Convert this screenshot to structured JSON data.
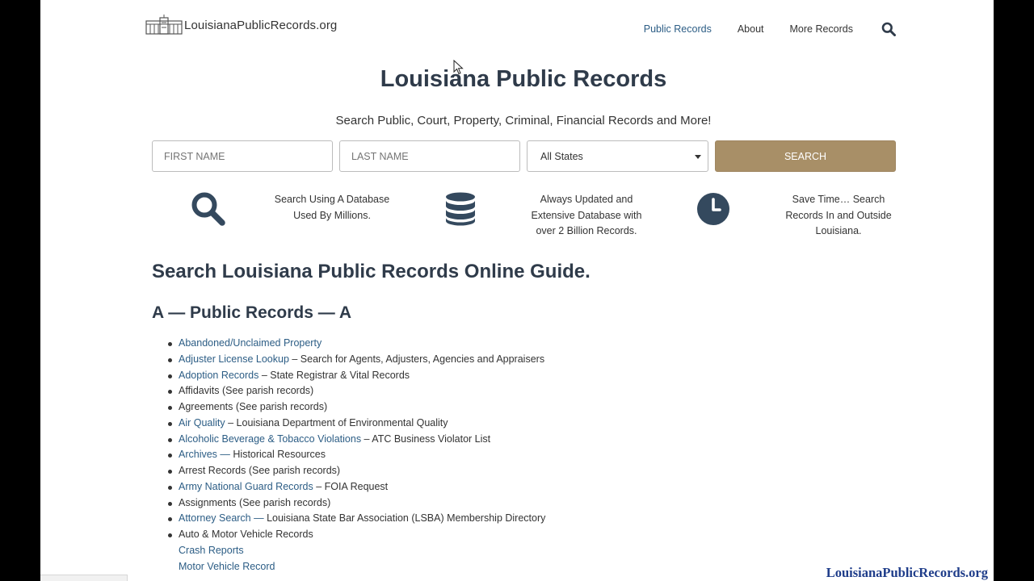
{
  "header": {
    "logo_text": "LouisianaPublicRecords.org",
    "nav": [
      {
        "label": "Public Records",
        "active": true
      },
      {
        "label": "About",
        "active": false
      },
      {
        "label": "More Records",
        "active": false
      }
    ],
    "search_icon": "search-icon"
  },
  "hero": {
    "title": "Louisiana Public Records",
    "subtitle": "Search Public, Court, Property, Criminal, Financial Records and More!"
  },
  "search_form": {
    "first_name_placeholder": "FIRST NAME",
    "last_name_placeholder": "LAST NAME",
    "state_selected": "All States",
    "button_label": "SEARCH",
    "button_color": "#a88f67"
  },
  "features": [
    {
      "icon": "magnifier-icon",
      "lines": [
        "Search Using A Database",
        "Used By Millions."
      ]
    },
    {
      "icon": "database-icon",
      "lines": [
        "Always Updated and",
        "Extensive Database with",
        "over 2 Billion Records."
      ]
    },
    {
      "icon": "clock-icon",
      "lines": [
        "Save Time… Search",
        "Records In and Outside",
        "Louisiana."
      ]
    }
  ],
  "guide": {
    "title": "Search Louisiana Public Records Online Guide.",
    "section_title": "A — Public Records — A",
    "items": [
      {
        "link": "Abandoned/Unclaimed Property",
        "text": ""
      },
      {
        "link": "Adjuster License Lookup",
        "text": " – Search for Agents, Adjusters, Agencies and Appraisers"
      },
      {
        "link": "Adoption Records",
        "text": " – State Registrar & Vital Records"
      },
      {
        "link": "",
        "text": "Affidavits (See parish records)"
      },
      {
        "link": "",
        "text": "Agreements (See parish records)"
      },
      {
        "link": "Air Quality",
        "text": " – Louisiana Department of Environmental Quality"
      },
      {
        "link": "Alcoholic Beverage & Tobacco Violations",
        "text": " – ATC Business Violator List"
      },
      {
        "link": "Archives — ",
        "text": "Historical Resources"
      },
      {
        "link": "",
        "text": "Arrest Records (See parish records)"
      },
      {
        "link": "Army National Guard Records",
        "text": " – FOIA Request"
      },
      {
        "link": "",
        "text": "Assignments (See parish records)"
      },
      {
        "link": "Attorney Search — ",
        "text": "Louisiana State Bar Association (LSBA) Membership Directory"
      },
      {
        "link": "",
        "text": "Auto & Motor Vehicle Records"
      }
    ],
    "sub_items": [
      "Crash Reports",
      "Motor Vehicle Record"
    ]
  },
  "watermark": "LouisianaPublicRecords.org",
  "colors": {
    "link": "#2c5d85",
    "heading": "#2f3b4a",
    "watermark": "#1f3d8a"
  }
}
